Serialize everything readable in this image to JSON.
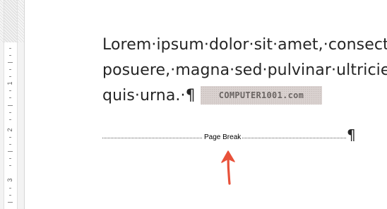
{
  "ruler": {
    "numbers": [
      "1",
      "2",
      "3"
    ]
  },
  "document": {
    "line1": "Lorem·ipsum·dolor·sit·amet,·consecte",
    "line2": "posuere,·magna·sed·pulvinar·ultricies,",
    "line3": "quis·urna.·¶"
  },
  "watermark": {
    "text": "COMPUTER1001.com"
  },
  "page_break": {
    "label": "Page Break",
    "pilcrow": "¶"
  },
  "colors": {
    "text": "#262626",
    "arrow": "#e8513a",
    "watermark_bg": "#d9d1cf"
  }
}
